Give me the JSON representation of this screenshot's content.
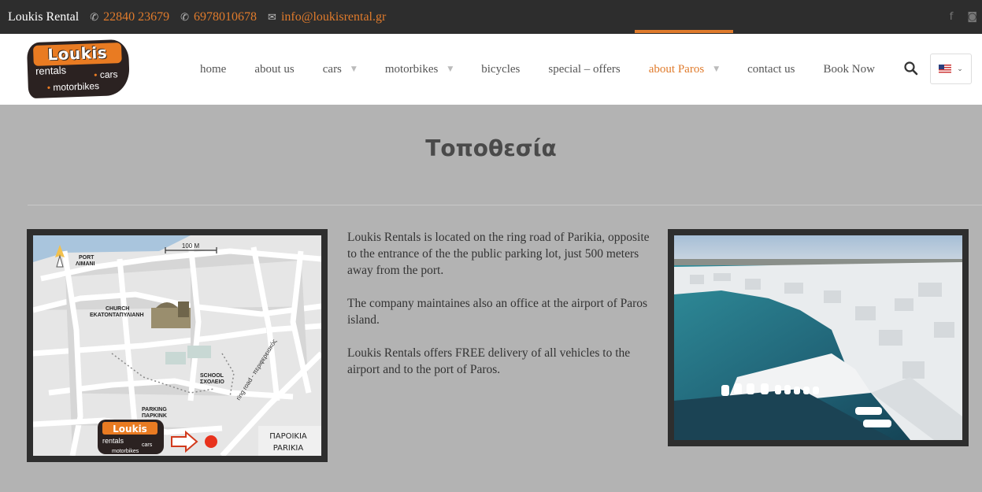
{
  "topbar": {
    "brand": "Loukis Rental",
    "phone1": "22840 23679",
    "phone2": "6978010678",
    "email": "info@loukisrental.gr",
    "social": [
      "facebook-icon",
      "instagram-icon"
    ]
  },
  "logo": {
    "line1": "Loukis",
    "line2": "rentals",
    "line3": "cars",
    "line4": "motorbikes"
  },
  "nav": {
    "items": [
      {
        "label": "home"
      },
      {
        "label": "about us"
      },
      {
        "label": "cars"
      },
      {
        "label": "motorbikes"
      },
      {
        "label": "bicycles"
      },
      {
        "label": "special – offers"
      },
      {
        "label": "about Paros"
      },
      {
        "label": "contact us"
      },
      {
        "label": "Book Now"
      }
    ],
    "accent": "#e07b2c"
  },
  "page": {
    "title": "Τοποθεσία",
    "paragraphs": [
      "Loukis Rentals is located on the ring road of Parikia, opposite to the entrance of the the public parking lot, just 500 meters away from the port.",
      "The company maintaines also an office at the airport of Paros island.",
      "Loukis Rentals offers FREE delivery of all vehicles to the airport and to the port of Paros."
    ]
  },
  "map": {
    "scale": "100 M",
    "port_en": "PORT",
    "port_gr": "ΛΙΜΑΝΙ",
    "church_en": "CHURCH",
    "church_gr": "ΕΚΑΤΟΝΤΑΠΥΛΙΑΝΗ",
    "school_en": "SCHOOL",
    "school_gr": "ΣΧΟΛΕΙΟ",
    "parking_en": "PARKING",
    "parking_gr": "ΠΑΡΚΙΝΚ",
    "road": "ring road - περιφερειακός",
    "town_gr": "ΠΑΡΟΙΚΙΑ",
    "town_en": "PARIKIA",
    "logo_line1": "Loukis",
    "logo_line2": "rentals",
    "logo_line3": "cars",
    "logo_line4": "motorbikes"
  }
}
